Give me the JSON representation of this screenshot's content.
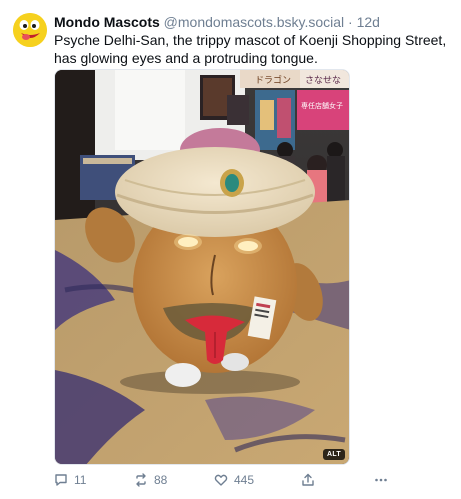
{
  "post": {
    "display_name": "Mondo Mascots",
    "handle": "@mondomascots.bsky.social",
    "separator": "·",
    "time_ago": "12d",
    "text": "Psyche Delhi-San, the trippy mascot of Koenji Shopping Street, has glowing eyes and a protruding tongue.",
    "image_alt_badge": "ALT",
    "sign_text_top": "ドラゴン",
    "sign_text_right": "さなせな",
    "banner_text": "専任店舗女子"
  },
  "actions": {
    "replies": "11",
    "reposts": "88",
    "likes": "445"
  },
  "icons": {
    "reply": "reply-icon",
    "repost": "repost-icon",
    "like": "heart-icon",
    "share": "share-icon",
    "more": "more-icon"
  },
  "colors": {
    "avatar_bg": "#f6d11e",
    "muted_text": "#6f7f92",
    "primary_text": "#0b0f14"
  }
}
